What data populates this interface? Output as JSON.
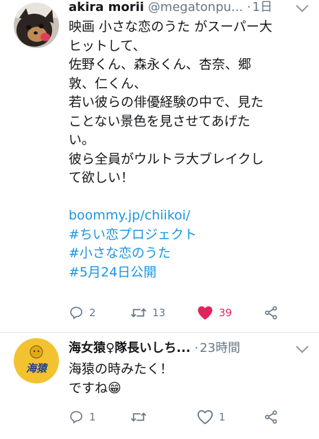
{
  "tweet1": {
    "name": "akira morii",
    "handle": "@megatonpu...",
    "time": "1日",
    "text_lines": [
      "映画 小さな恋のうた がスーパー大",
      "ヒットして、",
      "佐野くん、森永くん、杏奈、郷",
      "敦、仁くん、",
      "若い彼らの俳優経験の中で、見た",
      "ことない景色を見させてあげた",
      "い。",
      "彼ら全員がウルトラ大ブレイクし",
      "て欲しい！"
    ],
    "links": [
      "boommy.jp/chiikoi/",
      "#ちい恋プロジェクト",
      "#小さな恋のうた",
      "#5月24日公開"
    ],
    "reply_count": "2",
    "retweet_count": "13",
    "like_count": "39"
  },
  "tweet2": {
    "name": "海女猿♀隊長いしち...",
    "time": "23時間",
    "avatar_text": "海猿",
    "text_lines": [
      "海猿の時みたく！",
      "ですね😁"
    ],
    "reply_count": "1",
    "like_count": "1"
  },
  "colors": {
    "link": "#1b95e0",
    "like_active": "#e0245e",
    "muted": "#657786",
    "divider": "#e1e8ed"
  }
}
